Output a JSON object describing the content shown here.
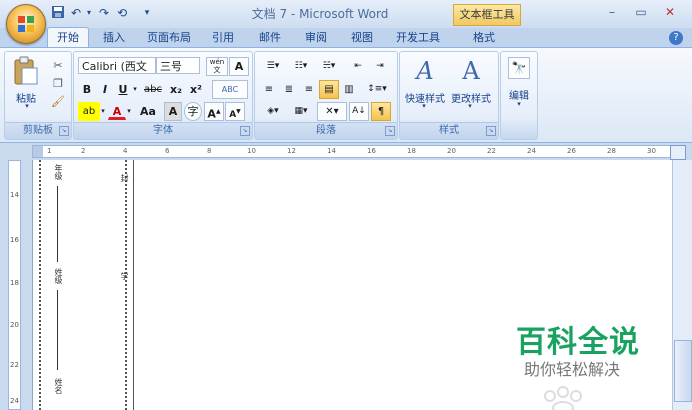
{
  "title_bar": {
    "title": "文档 7 - Microsoft Word",
    "context_tab": "文本框工具",
    "minimize": "–",
    "restore": "▭",
    "close": "✕",
    "quick_access": [
      "save-icon",
      "undo-icon",
      "undo-dropdown-icon",
      "redo-icon",
      "repeat-icon",
      "customize-icon"
    ]
  },
  "tabs": [
    "开始",
    "插入",
    "页面布局",
    "引用",
    "邮件",
    "审阅",
    "视图",
    "开发工具",
    "格式"
  ],
  "active_tab": "开始",
  "ribbon": {
    "clipboard": {
      "label": "剪贴板",
      "paste": "粘贴"
    },
    "font": {
      "label": "字体",
      "font_name": "Calibri (西文",
      "font_size": "三号",
      "bold": "B",
      "italic": "I",
      "underline": "U",
      "strike": "abc",
      "subscript": "x₂",
      "superscript": "x²",
      "font_color": "A",
      "change_case": "Aa",
      "grow": "A",
      "shrink": "A",
      "wen": "wén\n文",
      "char_border": "A",
      "highlight": "ab"
    },
    "paragraph": {
      "label": "段落"
    },
    "styles": {
      "label": "样式",
      "quick_styles": "快速样式",
      "change_styles": "更改样式"
    },
    "editing": {
      "label": "编辑"
    }
  },
  "ruler": {
    "h_ticks": [
      "1",
      "2",
      "4",
      "6",
      "8",
      "10",
      "12",
      "14",
      "16",
      "18",
      "20",
      "22",
      "24",
      "26",
      "28",
      "30"
    ],
    "v_ticks": [
      "14",
      "16",
      "18",
      "20",
      "22",
      "24"
    ]
  },
  "document": {
    "vertical_texts": [
      "年级",
      "姓名",
      "姓级",
      "学",
      "封"
    ]
  },
  "watermark": {
    "title": "百科全说",
    "subtitle": "助你轻松解决"
  },
  "colors": {
    "accent": "#15428b",
    "watermark_green": "#1aa260"
  }
}
